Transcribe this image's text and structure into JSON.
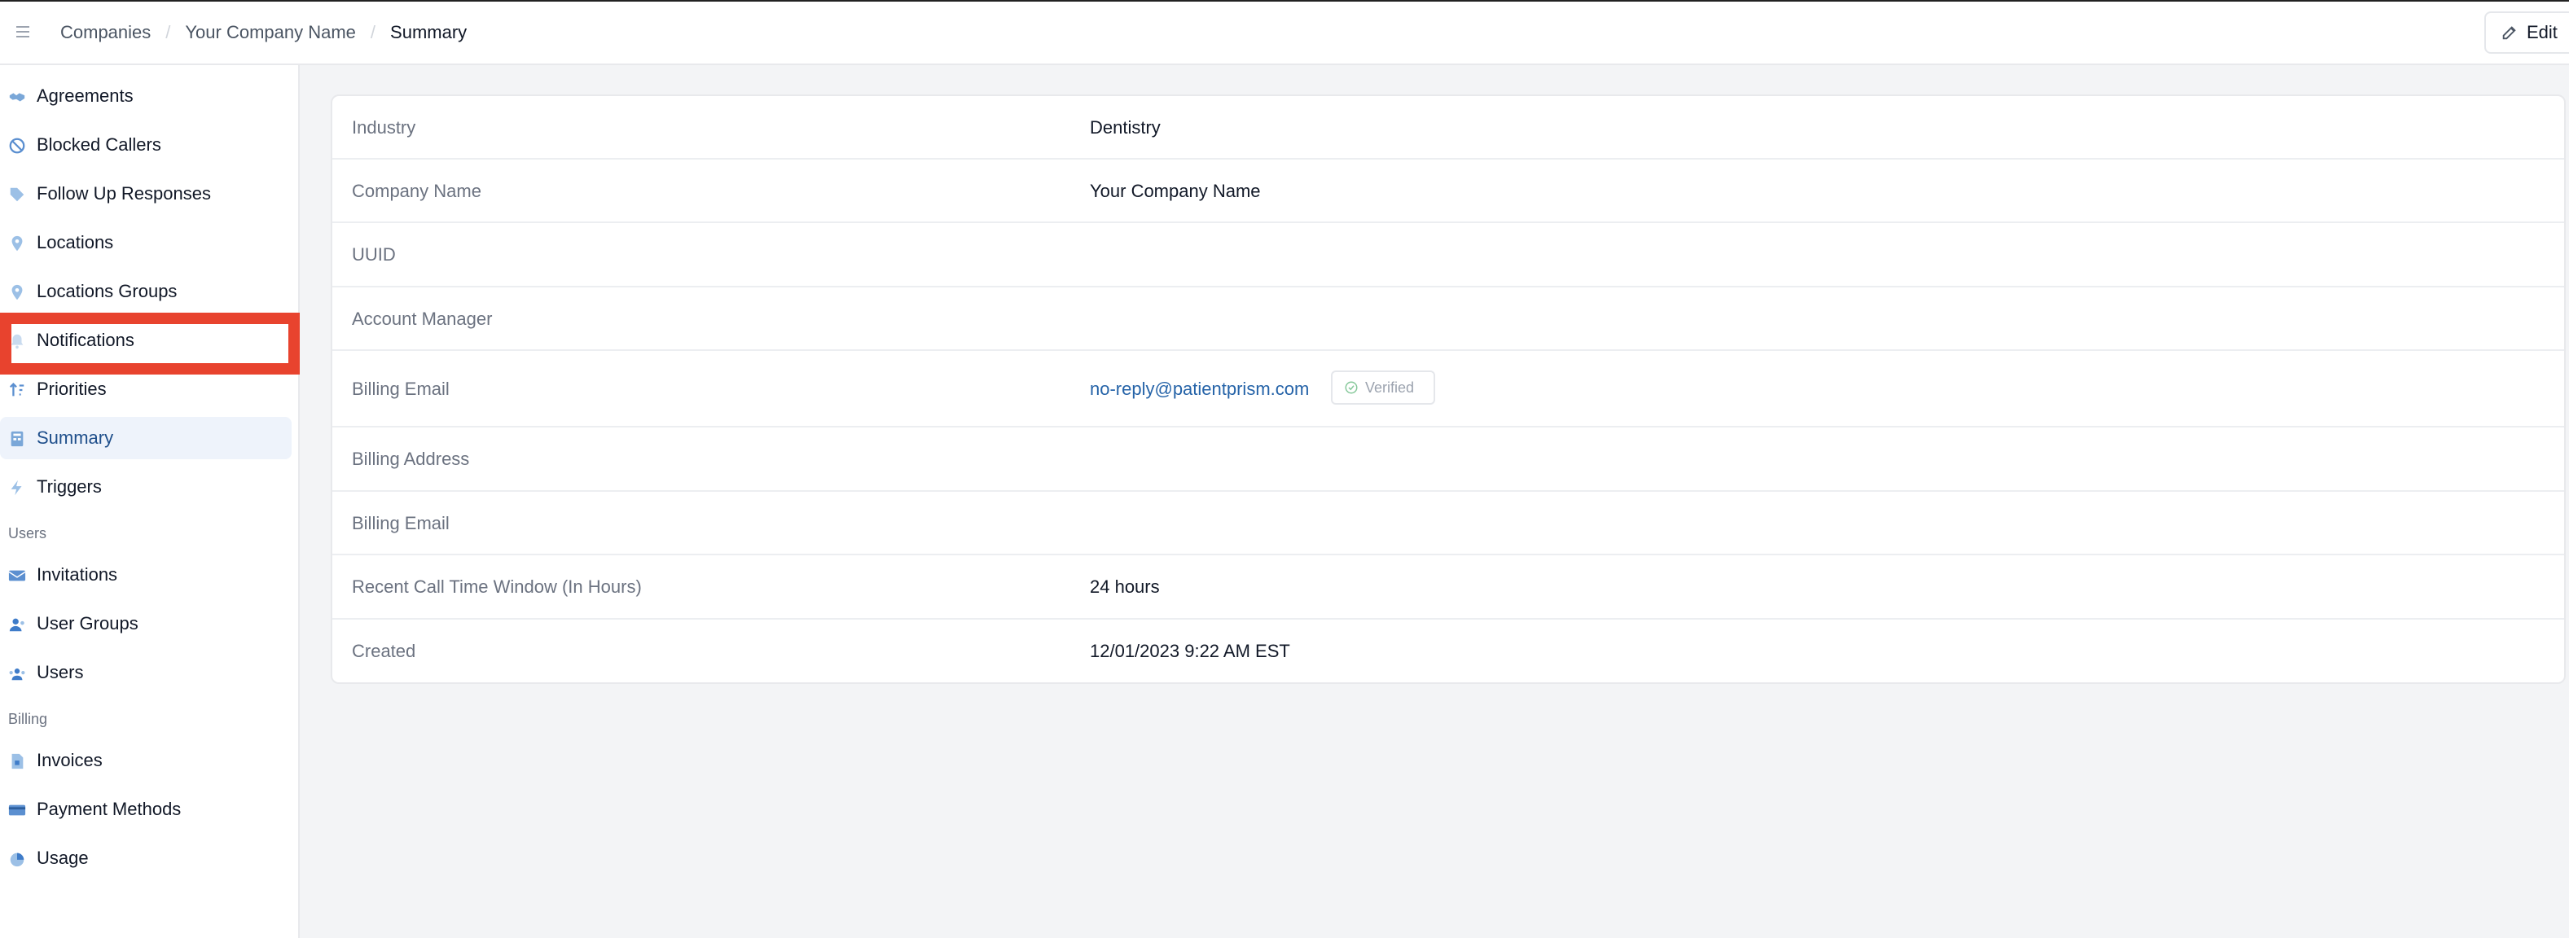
{
  "header": {
    "breadcrumb": [
      "Companies",
      "Your Company Name",
      "Summary"
    ],
    "edit_label": "Edit"
  },
  "sidebar": {
    "items": [
      {
        "label": "Agreements",
        "icon": "handshake-icon"
      },
      {
        "label": "Blocked Callers",
        "icon": "blocked-icon"
      },
      {
        "label": "Follow Up Responses",
        "icon": "tag-icon"
      },
      {
        "label": "Locations",
        "icon": "location-pin-icon"
      },
      {
        "label": "Locations Groups",
        "icon": "location-pin-icon"
      },
      {
        "label": "Notifications",
        "icon": "bell-icon"
      },
      {
        "label": "Priorities",
        "icon": "sort-icon"
      },
      {
        "label": "Summary",
        "icon": "building-icon",
        "active": true
      },
      {
        "label": "Triggers",
        "icon": "lightning-icon"
      }
    ],
    "users_section": "Users",
    "users_items": [
      {
        "label": "Invitations",
        "icon": "envelope-icon"
      },
      {
        "label": "User Groups",
        "icon": "user-group-icon"
      },
      {
        "label": "Users",
        "icon": "users-icon"
      }
    ],
    "billing_section": "Billing",
    "billing_items": [
      {
        "label": "Invoices",
        "icon": "document-icon"
      },
      {
        "label": "Payment Methods",
        "icon": "credit-card-icon"
      },
      {
        "label": "Usage",
        "icon": "pie-chart-icon"
      }
    ]
  },
  "details": {
    "rows": [
      {
        "key": "Industry",
        "value": "Dentistry"
      },
      {
        "key": "Company Name",
        "value": "Your Company Name"
      },
      {
        "key": "UUID",
        "value": ""
      },
      {
        "key": "Account Manager",
        "value": ""
      },
      {
        "key": "Billing Email",
        "value": "no-reply@patientprism.com",
        "badge": "Verified"
      },
      {
        "key": "Billing Address",
        "value": ""
      },
      {
        "key": "Billing Email",
        "value": ""
      },
      {
        "key": "Recent Call Time Window (In Hours)",
        "value": "24 hours"
      },
      {
        "key": "Created",
        "value": "12/01/2023 9:22 AM EST"
      }
    ]
  },
  "colors": {
    "accent": "#2563a8",
    "highlight": "#e8432e",
    "active_bg": "#eef3fb",
    "icon": "#7aa7d8"
  }
}
